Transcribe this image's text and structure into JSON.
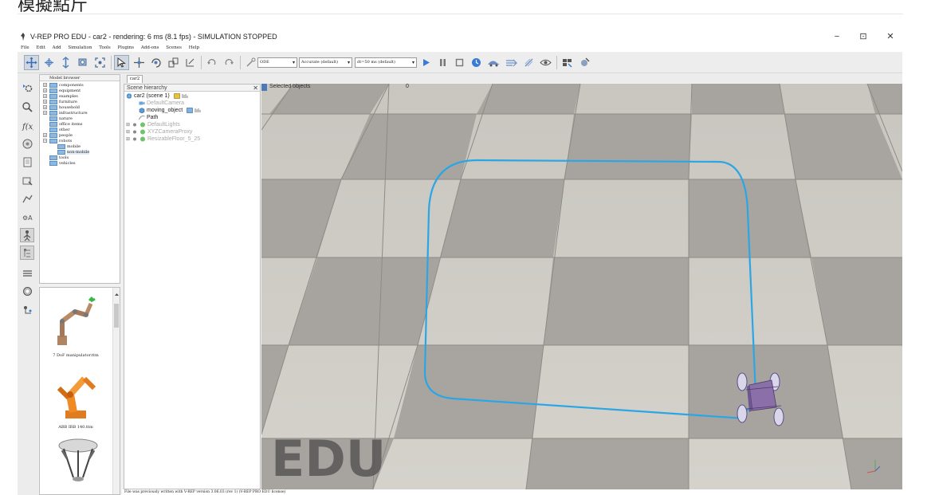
{
  "page_heading": "模擬點斤",
  "window": {
    "title": "V-REP PRO EDU - car2 - rendering: 6 ms (8.1 fps) - SIMULATION STOPPED",
    "minimize": "−",
    "restore": "⊡",
    "close": "✕"
  },
  "menu": [
    "File",
    "Edit",
    "Add",
    "Simulation",
    "Tools",
    "Plugins",
    "Add-ons",
    "Scenes",
    "Help"
  ],
  "toolbar": {
    "buttons": [
      "camera-pan-icon",
      "camera-rotate-icon",
      "camera-shift-icon",
      "camera-zoom-icon",
      "camera-fit-icon",
      "object-select-icon",
      "object-shift-icon",
      "object-rotate-icon",
      "assembly-icon",
      "transfer-dna-icon",
      "undo-icon",
      "redo-icon",
      "collision-icon"
    ],
    "engine": "ODE",
    "accuracy": "Accurate (default)",
    "timestep": "dt=50 ms (default)",
    "sim_buttons": [
      "play-icon",
      "pause-icon",
      "stop-icon",
      "realtime-icon",
      "slow-icon",
      "fast-icon",
      "thread-icon",
      "visualization-icon",
      "page-selector-icon",
      "scene-selector-icon"
    ]
  },
  "left_icons": [
    "simulation-settings-icon",
    "magnifier-icon",
    "function-fx-icon",
    "objects-icon",
    "document-icon",
    "shapes-icon",
    "path-icon",
    "model-properties-icon",
    "scene-hierarchy-icon",
    "model-browser-icon",
    "layers-icon",
    "renderer-icon",
    "selection-icon"
  ],
  "model_browser": {
    "header": "Model browser",
    "items": [
      {
        "label": "components",
        "indent": 0,
        "exp": "+"
      },
      {
        "label": "equipment",
        "indent": 0,
        "exp": "+"
      },
      {
        "label": "examples",
        "indent": 0,
        "exp": "+"
      },
      {
        "label": "furniture",
        "indent": 0,
        "exp": "+"
      },
      {
        "label": "household",
        "indent": 0,
        "exp": "+"
      },
      {
        "label": "infrastructure",
        "indent": 0,
        "exp": "+"
      },
      {
        "label": "nature",
        "indent": 0,
        "exp": ""
      },
      {
        "label": "office items",
        "indent": 0,
        "exp": ""
      },
      {
        "label": "other",
        "indent": 0,
        "exp": ""
      },
      {
        "label": "people",
        "indent": 0,
        "exp": "+"
      },
      {
        "label": "robots",
        "indent": 0,
        "exp": "−"
      },
      {
        "label": "mobile",
        "indent": 1,
        "exp": ""
      },
      {
        "label": "non-mobile",
        "indent": 1,
        "exp": "",
        "selected": true
      },
      {
        "label": "tools",
        "indent": 0,
        "exp": ""
      },
      {
        "label": "vehicles",
        "indent": 0,
        "exp": ""
      }
    ]
  },
  "thumbnails": [
    {
      "caption": "7 DoF manipulator.ttm"
    },
    {
      "caption": "ABB IRB 140.ttm"
    }
  ],
  "doc_tab": "car2",
  "scene_hierarchy": {
    "header": "Scene hierarchy",
    "close": "✕",
    "items": [
      {
        "label": "car2 (scene 1)",
        "dim": false,
        "indent": 0
      },
      {
        "label": "DefaultCamera",
        "dim": true,
        "indent": 1
      },
      {
        "label": "moving_object",
        "dim": false,
        "indent": 1
      },
      {
        "label": "Path",
        "dim": false,
        "indent": 1
      },
      {
        "label": "DefaultLights",
        "dim": true,
        "indent": 1
      },
      {
        "label": "XYZCameraProxy",
        "dim": true,
        "indent": 1
      },
      {
        "label": "ResizableFloor_5_25",
        "dim": true,
        "indent": 1
      }
    ]
  },
  "viewport": {
    "selected_label": "Selected objects",
    "selected_count": "0",
    "watermark": "EDU",
    "path_color": "#2aa6e4",
    "robot_color": "#8a6fa8"
  },
  "status": "File was previously written with V-REP version 3.06.03 (rev 1) (V-REP PRO EDU license)"
}
